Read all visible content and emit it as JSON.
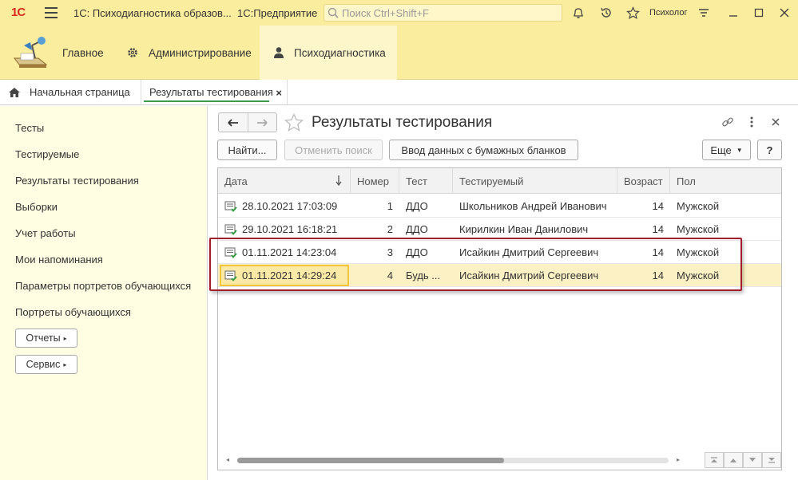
{
  "titlebar": {
    "logo_text": "1С",
    "app_title": "1С: Психодиагностика образов...",
    "platform": "1С:Предприятие",
    "search_placeholder": "Поиск Ctrl+Shift+F",
    "user": "Психолог"
  },
  "sections": [
    {
      "label": "Главное",
      "icon": "desk-lamp-icon"
    },
    {
      "label": "Администрирование",
      "icon": "gear-icon"
    },
    {
      "label": "Психодиагностика",
      "icon": "person-icon"
    }
  ],
  "tabs": {
    "home": "Начальная страница",
    "current": "Результаты тестирования",
    "close": "×"
  },
  "left_panel": {
    "items": [
      "Тесты",
      "Тестируемые",
      "Результаты тестирования",
      "Выборки",
      "Учет работы",
      "Мои напоминания",
      "Параметры портретов обучающихся",
      "Портреты обучающихся"
    ],
    "buttons": [
      "Отчеты",
      "Сервис"
    ]
  },
  "form": {
    "title": "Результаты тестирования",
    "buttons": {
      "find": "Найти...",
      "cancel_search": "Отменить поиск",
      "paper_input": "Ввод данных с бумажных бланков",
      "more": "Еще",
      "help": "?"
    }
  },
  "table": {
    "columns": [
      "Дата",
      "Номер",
      "Тест",
      "Тестируемый",
      "Возраст",
      "Пол"
    ],
    "rows": [
      {
        "date": "28.10.2021 17:03:09",
        "number": "1",
        "test": "ДДО",
        "person": "Школьников Андрей Иванович",
        "age": "14",
        "sex": "Мужской"
      },
      {
        "date": "29.10.2021 16:18:21",
        "number": "2",
        "test": "ДДО",
        "person": "Кирилкин Иван Данилович",
        "age": "14",
        "sex": "Мужской"
      },
      {
        "date": "01.11.2021 14:23:04",
        "number": "3",
        "test": "ДДО",
        "person": "Исайкин Дмитрий Сергеевич",
        "age": "14",
        "sex": "Мужской"
      },
      {
        "date": "01.11.2021 14:29:24",
        "number": "4",
        "test": "Будь ...",
        "person": "Исайкин Дмитрий Сергеевич",
        "age": "14",
        "sex": "Мужской"
      }
    ],
    "selected_row": 3
  },
  "colors": {
    "header_bg": "#fbed9e",
    "panel_bg": "#fffde2",
    "highlight_box": "#a21e2c",
    "selection": "#fbf1c4"
  }
}
